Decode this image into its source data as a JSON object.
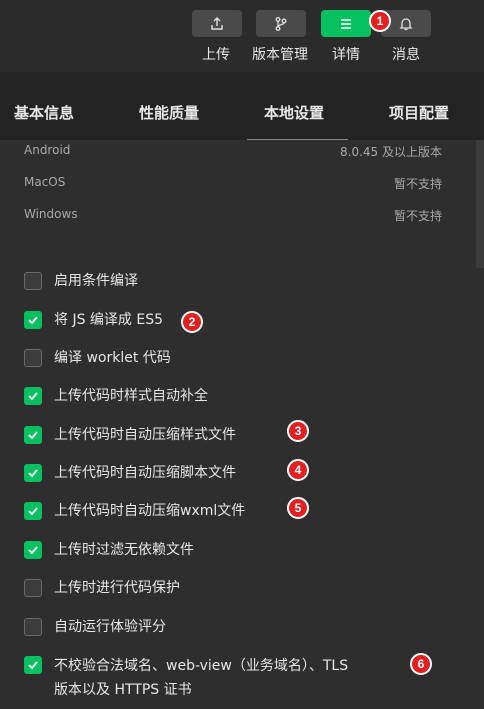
{
  "toolbar": {
    "buttons": [
      {
        "label": "上传",
        "icon": "upload-icon",
        "active": false
      },
      {
        "label": "版本管理",
        "icon": "branch-icon",
        "active": false
      },
      {
        "label": "详情",
        "icon": "menu-icon",
        "active": true
      },
      {
        "label": "消息",
        "icon": "bell-icon",
        "active": false
      }
    ],
    "accent": "#07c160"
  },
  "tabs": [
    {
      "label": "基本信息"
    },
    {
      "label": "性能质量"
    },
    {
      "label": "本地设置",
      "selected": true
    },
    {
      "label": "项目配置"
    }
  ],
  "platforms": [
    {
      "name": "Android",
      "value": "8.0.45 及以上版本"
    },
    {
      "name": "MacOS",
      "value": "暂不支持"
    },
    {
      "name": "Windows",
      "value": "暂不支持"
    }
  ],
  "options": [
    {
      "label": "启用条件编译",
      "checked": false
    },
    {
      "label": "将 JS 编译成 ES5",
      "checked": true
    },
    {
      "label": "编译 worklet 代码",
      "checked": false
    },
    {
      "label": "上传代码时样式自动补全",
      "checked": true
    },
    {
      "label": "上传代码时自动压缩样式文件",
      "checked": true
    },
    {
      "label": "上传代码时自动压缩脚本文件",
      "checked": true
    },
    {
      "label": "上传代码时自动压缩wxml文件",
      "checked": true
    },
    {
      "label": "上传时过滤无依赖文件",
      "checked": true
    },
    {
      "label": "上传时进行代码保护",
      "checked": false
    },
    {
      "label": "自动运行体验评分",
      "checked": false
    },
    {
      "label": "不校验合法域名、web-view（业务域名）、TLS",
      "label_line2": "版本以及 HTTPS 证书",
      "checked": true
    }
  ],
  "badges": [
    "1",
    "2",
    "3",
    "4",
    "5",
    "6"
  ]
}
